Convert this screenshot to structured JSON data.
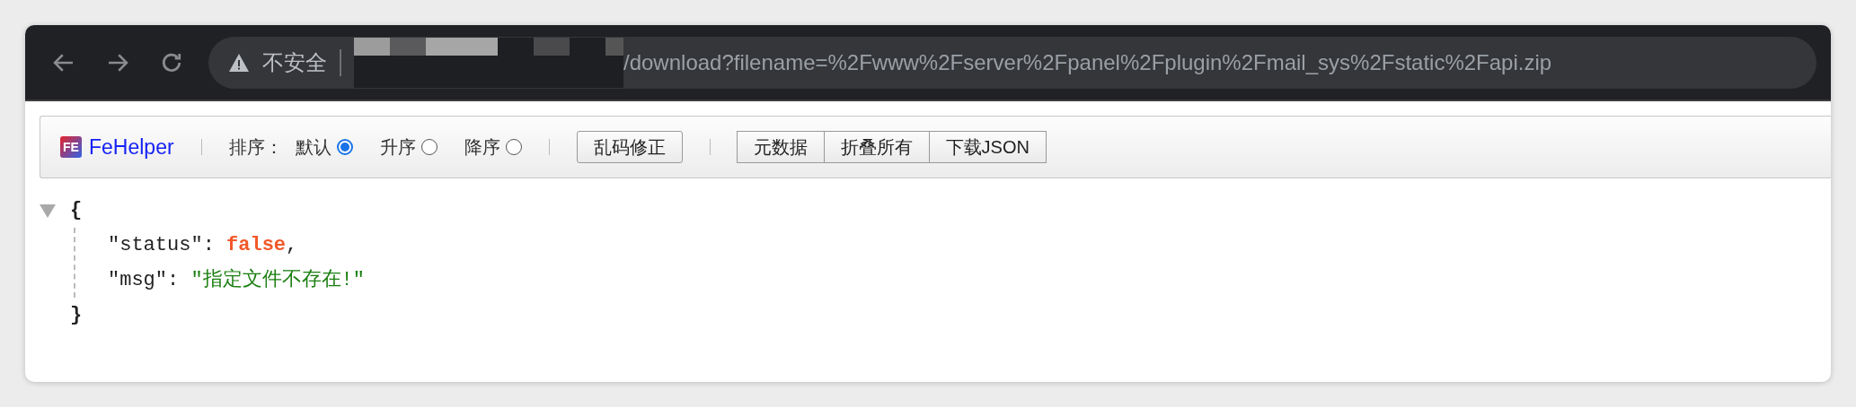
{
  "browser": {
    "security_label": "不安全",
    "url": "/download?filename=%2Fwww%2Fserver%2Fpanel%2Fplugin%2Fmail_sys%2Fstatic%2Fapi.zip"
  },
  "toolbar": {
    "logo_mark": "FE",
    "logo_text": "FeHelper",
    "sort_label": "排序：",
    "sort_options": [
      {
        "label": "默认",
        "selected": true
      },
      {
        "label": "升序",
        "selected": false
      },
      {
        "label": "降序",
        "selected": false
      }
    ],
    "fix_button": "乱码修正",
    "buttons": [
      "元数据",
      "折叠所有",
      "下载JSON"
    ]
  },
  "json_view": {
    "expanded": true,
    "open": "{",
    "close": "}",
    "entries": [
      {
        "key": "\"status\"",
        "colon": ":",
        "value": "false",
        "kind": "boolean",
        "comma": ","
      },
      {
        "key": "\"msg\"",
        "colon": ":",
        "value": "\"指定文件不存在!\"",
        "kind": "string"
      }
    ]
  }
}
